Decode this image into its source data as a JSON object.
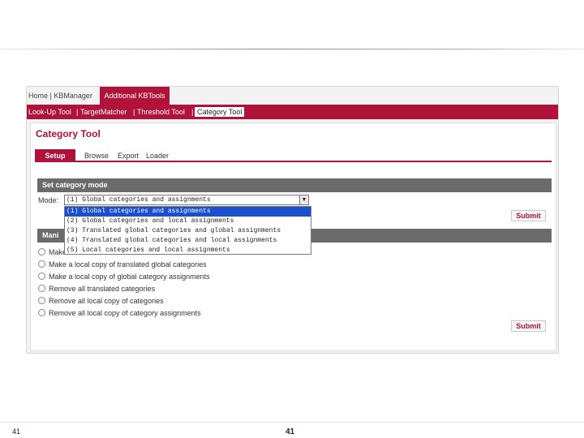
{
  "topnav": {
    "home_tab": "Home | KBManager",
    "tools_tab": "Additional KBTools"
  },
  "subnav": {
    "items": [
      "Look-Up Tool",
      "TargetMatcher",
      "Threshold Tool",
      "Category Tool"
    ],
    "separator": "|"
  },
  "panel": {
    "title": "Category Tool",
    "tabs": [
      "Setup",
      "Browse",
      "Export",
      "Loader"
    ]
  },
  "set_mode": {
    "header": "Set category mode",
    "label": "Mode:",
    "selected": "(1) Global categories and assignments",
    "options": [
      "(1) Global categories and assignments",
      "(2) Global categories and local assignments",
      "(3) Translated global categories and global assignments",
      "(4) Translated global categories and local assignments",
      "(5) Local categories and local assignments"
    ],
    "submit": "Submit"
  },
  "manage": {
    "header": "Mani",
    "options": [
      "Make",
      "Make a local copy of translated global categories",
      "Make a local copy of global category assignments",
      "Remove all translated categories",
      "Remove all local copy of categories",
      "Remove all local copy of category assignments"
    ],
    "submit": "Submit"
  },
  "footer": {
    "page_left": "41",
    "page_center": "41"
  },
  "colors": {
    "accent": "#b0123a",
    "section_bar": "#6b6b6b",
    "selected_option": "#1a4fd0"
  }
}
